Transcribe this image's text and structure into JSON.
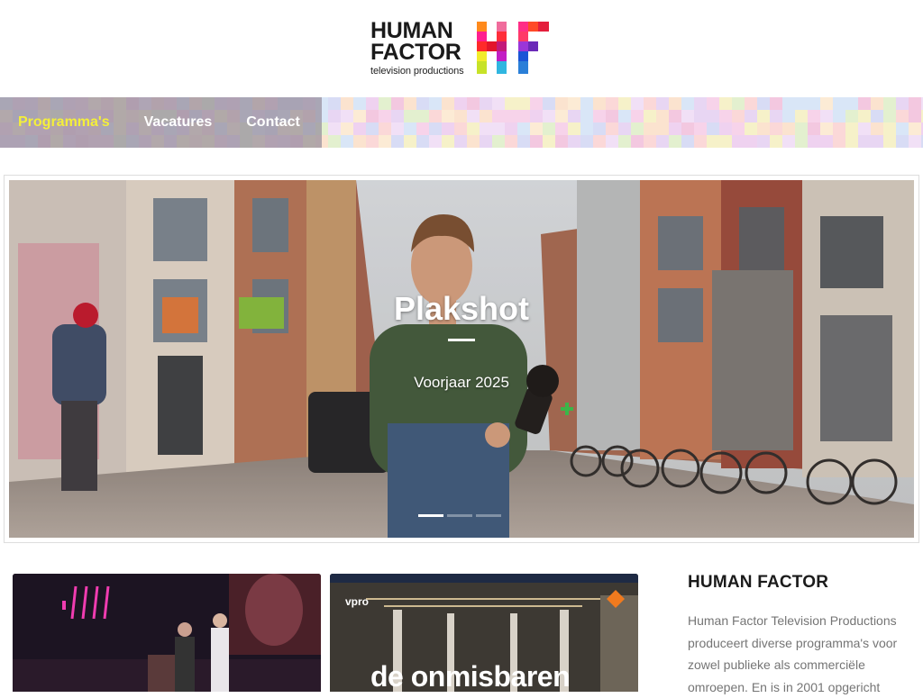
{
  "brand": {
    "line1": "HUMAN",
    "line2": "FACTOR",
    "tagline": "television productions"
  },
  "nav": {
    "items": [
      {
        "label": "Programma's",
        "active": true
      },
      {
        "label": "Vacatures",
        "active": false
      },
      {
        "label": "Contact",
        "active": false
      }
    ]
  },
  "slider": {
    "title": "Plakshot",
    "subtitle": "Voorjaar 2025",
    "dots_count": 3,
    "active_dot": 1
  },
  "cards": [
    {
      "logo": "",
      "title": ""
    },
    {
      "logo": "vpro",
      "title": "de onmisbaren"
    }
  ],
  "sidebar": {
    "title": "HUMAN FACTOR",
    "text": "Human Factor Television Productions produceert diverse programma's voor zowel publieke als commerciële omroepen. En is in 2001 opgericht"
  },
  "colors": {
    "nav_active": "#f4ef3a",
    "nav_text": "#ffffff",
    "sidebar_text": "#757575"
  }
}
